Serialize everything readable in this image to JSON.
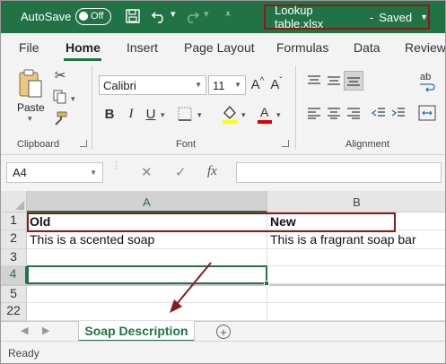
{
  "titlebar": {
    "autosave_label": "AutoSave",
    "autosave_state": "Off",
    "filename": "Lookup table.xlsx",
    "separator": "-",
    "save_status": "Saved",
    "accent": "#217346"
  },
  "tabs": [
    {
      "label": "File"
    },
    {
      "label": "Home"
    },
    {
      "label": "Insert"
    },
    {
      "label": "Page Layout"
    },
    {
      "label": "Formulas"
    },
    {
      "label": "Data"
    },
    {
      "label": "Review"
    }
  ],
  "ribbon": {
    "clipboard": {
      "paste_label": "Paste",
      "group_label": "Clipboard"
    },
    "font": {
      "family": "Calibri",
      "size": "11",
      "group_label": "Font",
      "bold": "B",
      "italic": "I",
      "underline": "U",
      "grow": "A^",
      "shrink": "Aˇ",
      "fill_color": "#ffff00",
      "font_color": "#e00000"
    },
    "alignment": {
      "group_label": "Alignment",
      "wrap_label": "ab"
    }
  },
  "formula_bar": {
    "name_box": "A4",
    "cancel_icon": "✕",
    "enter_icon": "✓",
    "fx_label": "fx",
    "value": ""
  },
  "grid": {
    "columns": [
      "A",
      "B"
    ],
    "rows": [
      {
        "num": "1",
        "a": "Old",
        "b": "New"
      },
      {
        "num": "2",
        "a": "This is a scented soap",
        "b": "This is a fragrant soap bar"
      },
      {
        "num": "3",
        "a": "",
        "b": ""
      },
      {
        "num": "4",
        "a": "",
        "b": ""
      },
      {
        "num": "5",
        "a": "",
        "b": ""
      },
      {
        "num": "22",
        "a": "",
        "b": ""
      }
    ]
  },
  "sheets": {
    "active": "Soap Description",
    "add_label": "+"
  },
  "status": {
    "text": "Ready"
  },
  "annotation_colors": {
    "highlight_box": "#8b1a1a",
    "arrow": "#8b1a1a"
  }
}
